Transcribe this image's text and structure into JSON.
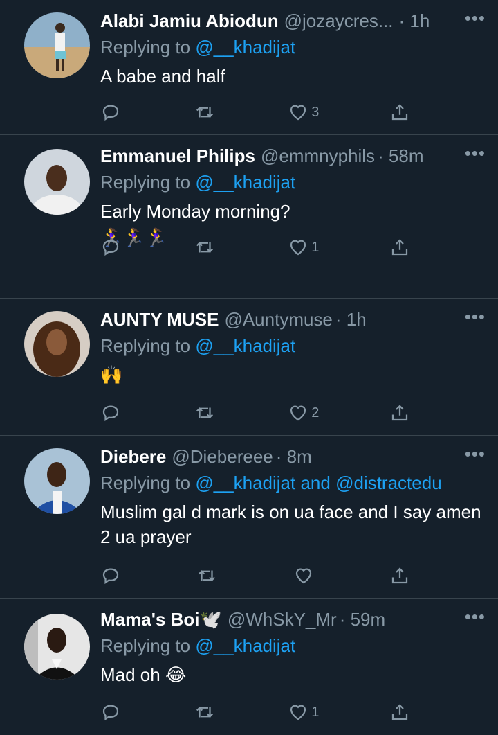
{
  "tweets": [
    {
      "name": "Alabi Jamiu Abiodun",
      "handle": "@jozaycres...",
      "time": "· 1h",
      "replying_prefix": "Replying to ",
      "mentions": "@__khadijat",
      "mentions_sep": "",
      "mentions_2": "",
      "text": "A babe and half",
      "extra": "",
      "likes": "3"
    },
    {
      "name": "Emmanuel Philips",
      "handle": "@emmnyphils",
      "time": "· 58m",
      "replying_prefix": "Replying to ",
      "mentions": "@__khadijat",
      "mentions_sep": "",
      "mentions_2": "",
      "text": "Early Monday morning?",
      "extra": "🏃‍♀️🏃‍♀️🏃‍♀️",
      "likes": "1"
    },
    {
      "name": "AUNTY MUSE",
      "handle": "@Auntymuse",
      "time": "· 1h",
      "replying_prefix": "Replying to ",
      "mentions": "@__khadijat",
      "mentions_sep": "",
      "mentions_2": "",
      "text": "🙌",
      "extra": "",
      "likes": "2"
    },
    {
      "name": "Diebere",
      "handle": "@Diebereee",
      "time": "· 8m",
      "replying_prefix": "Replying to ",
      "mentions": "@__khadijat",
      "mentions_sep": " and ",
      "mentions_2": "@distractedu",
      "text": "Muslim gal d mark is on ua face and I say amen 2 ua prayer",
      "extra": "",
      "likes": ""
    },
    {
      "name": "Mama's Boi🕊️",
      "handle": "@WhSkY_Mr",
      "time": "· 59m",
      "replying_prefix": "Replying to ",
      "mentions": "@__khadijat",
      "mentions_sep": "",
      "mentions_2": "",
      "text": "Mad oh 😂",
      "extra": "",
      "likes": "1"
    }
  ],
  "icons": {
    "more": "more-dots-icon",
    "reply": "reply-bubble-icon",
    "retweet": "retweet-icon",
    "like": "heart-icon",
    "share": "share-icon"
  },
  "colors": {
    "background": "#15202b",
    "mention": "#1da1f2",
    "secondary_text": "#8899a6",
    "divider": "#38444d"
  }
}
